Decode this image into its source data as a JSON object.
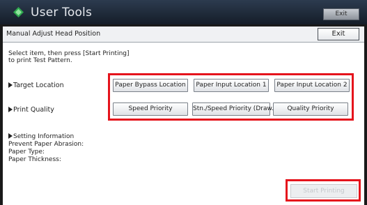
{
  "app": {
    "title": "User Tools",
    "exit_label": "Exit"
  },
  "screen": {
    "title": "Manual Adjust Head Position",
    "exit_label": "Exit",
    "instruction_line1": "Select item, then press [Start Printing]",
    "instruction_line2": "to print Test Pattern."
  },
  "target_location": {
    "label": "Target Location",
    "options": [
      "Paper Bypass Location",
      "Paper Input Location 1",
      "Paper Input Location 2"
    ]
  },
  "print_quality": {
    "label": "Print Quality",
    "options": [
      "Speed Priority",
      "Stn./Speed Priority (Draw.)",
      "Quality Priority"
    ]
  },
  "setting_information": {
    "heading": "Setting Information",
    "lines": [
      "Prevent Paper Abrasion:",
      "Paper Type:",
      "Paper Thickness:"
    ]
  },
  "start_printing_label": "Start Printing",
  "colors": {
    "highlight": "#e5141c",
    "titlebar": "#1f2a38"
  }
}
